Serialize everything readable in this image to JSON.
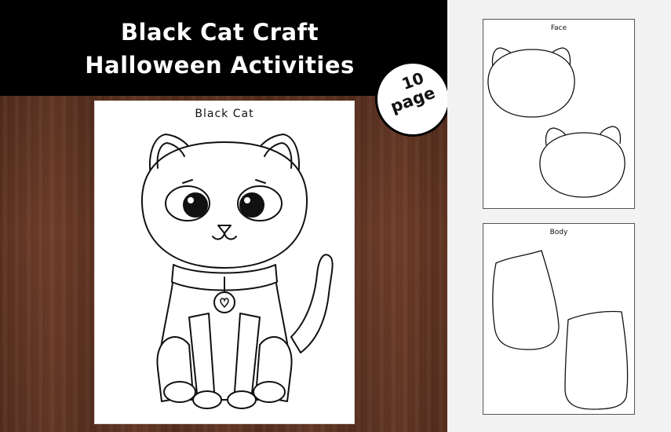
{
  "header": {
    "title_line1": "Black Cat Craft",
    "title_line2": "Halloween Activities"
  },
  "badge": {
    "number": "10",
    "label": "page"
  },
  "main_sheet": {
    "title": "Black Cat"
  },
  "thumbnails": [
    {
      "title": "Face"
    },
    {
      "title": "Body"
    }
  ],
  "colors": {
    "banner": "#000000",
    "wood": "#5e3424",
    "page": "#ffffff",
    "background": "#f2f2f2"
  }
}
